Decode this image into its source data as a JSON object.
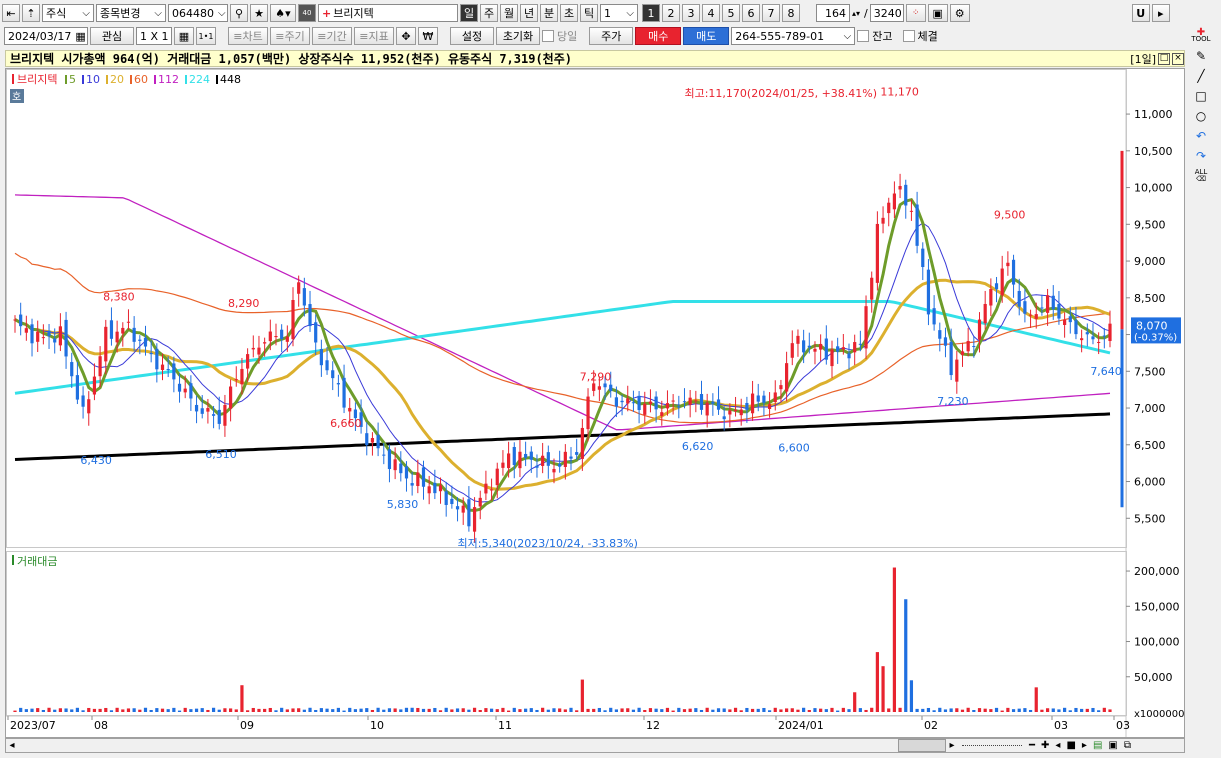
{
  "toolbar": {
    "market": "주식",
    "change_code": "종목변경",
    "code": "064480",
    "stock_name": "브리지텍",
    "periods": [
      "일",
      "주",
      "월",
      "년",
      "분",
      "초",
      "틱"
    ],
    "period_value": "1",
    "pages": [
      "1",
      "2",
      "3",
      "4",
      "5",
      "6",
      "7",
      "8"
    ],
    "count": "164",
    "total": "3240",
    "date": "2024/03/17",
    "watch": "관심",
    "layout": "1 X 1",
    "layout2": "1•1",
    "tabs": [
      "차트",
      "주기",
      "기간",
      "지표"
    ],
    "setting": "설정",
    "reset": "초기화",
    "today": "당일",
    "price_mode": "주가",
    "buy": "매수",
    "sell": "매도",
    "account": "264-555-789-01",
    "balance": "잔고",
    "filled": "체결",
    "u_button": "U",
    "tool_label": "TOOL",
    "all_label": "ALL"
  },
  "info": {
    "text": "브리지텍  시가총액 964(억)  거래대금 1,057(백만)  상장주식수 11,952(천주)  유동주식 7,319(천주)",
    "period_tag": "[1일]"
  },
  "colors": {
    "up": "#e8232f",
    "down": "#1f6fe0",
    "ma5": "#6e9c2a",
    "ma10": "#3a3ad8",
    "ma20": "#dcb02e",
    "ma60": "#e8622a",
    "ma112": "#c020c0",
    "ma224": "#33e0e8",
    "ma448": "#000000"
  },
  "chart_data": {
    "type": "candlestick",
    "title": "브리지텍",
    "legend": [
      "브리지텍",
      "5",
      "10",
      "20",
      "60",
      "112",
      "224",
      "448"
    ],
    "price_axis_ticks": [
      5500,
      6000,
      6500,
      7000,
      7500,
      8000,
      8500,
      9000,
      9500,
      10000,
      10500,
      11000
    ],
    "price_axis_labels": [
      "5,500",
      "6,000",
      "6,500",
      "7,000",
      "7,500",
      "8,000",
      "8,500",
      "9,000",
      "9,500",
      "10,000",
      "10,500",
      "11,000"
    ],
    "ylim": [
      5150,
      11450
    ],
    "current_price": "8,070",
    "current_change": "(-0.37%)",
    "x_labels": [
      "2023/07",
      "08",
      "09",
      "10",
      "11",
      "12",
      "2024/01",
      "02",
      "03",
      "03"
    ],
    "annotations": [
      {
        "text": "8,380",
        "value": 8380,
        "kind": "high"
      },
      {
        "text": "8,290",
        "value": 8290,
        "kind": "high"
      },
      {
        "text": "6,660",
        "value": 6660,
        "kind": "high"
      },
      {
        "text": "7,290",
        "value": 7290,
        "kind": "high"
      },
      {
        "text": "11,170",
        "value": 11170,
        "kind": "high"
      },
      {
        "text": "9,500",
        "value": 9500,
        "kind": "high"
      },
      {
        "text": "6,430",
        "value": 6430,
        "kind": "low"
      },
      {
        "text": "6,510",
        "value": 6510,
        "kind": "low"
      },
      {
        "text": "5,830",
        "value": 5830,
        "kind": "low"
      },
      {
        "text": "6,620",
        "value": 6620,
        "kind": "low"
      },
      {
        "text": "6,600",
        "value": 6600,
        "kind": "low"
      },
      {
        "text": "7,230",
        "value": 7230,
        "kind": "low"
      },
      {
        "text": "7,640",
        "value": 7640,
        "kind": "low"
      }
    ],
    "max_label": "최고:11,170(2024/01/25, +38.41%)",
    "min_label": "최저:5,340(2023/10/24, -33.83%)",
    "volume_title": "거래대금",
    "volume_ticks": [
      "50,000",
      "100,000",
      "150,000",
      "200,000"
    ],
    "volume_unit": "x1000000",
    "volume_ylim": [
      0,
      210000
    ],
    "anchor_closes": [
      [
        0,
        8150
      ],
      [
        4,
        7950
      ],
      [
        8,
        8000
      ],
      [
        12,
        6900
      ],
      [
        16,
        8000
      ],
      [
        20,
        8100
      ],
      [
        24,
        7700
      ],
      [
        28,
        7400
      ],
      [
        32,
        7000
      ],
      [
        36,
        6850
      ],
      [
        40,
        7600
      ],
      [
        44,
        7950
      ],
      [
        48,
        8000
      ],
      [
        50,
        8750
      ],
      [
        53,
        7800
      ],
      [
        57,
        7250
      ],
      [
        61,
        6700
      ],
      [
        65,
        6350
      ],
      [
        69,
        6050
      ],
      [
        73,
        5950
      ],
      [
        77,
        5700
      ],
      [
        80,
        5500
      ],
      [
        83,
        5900
      ],
      [
        87,
        6350
      ],
      [
        91,
        6300
      ],
      [
        95,
        6200
      ],
      [
        99,
        6400
      ],
      [
        102,
        7400
      ],
      [
        106,
        7100
      ],
      [
        110,
        7050
      ],
      [
        114,
        7000
      ],
      [
        118,
        7100
      ],
      [
        122,
        7050
      ],
      [
        126,
        6900
      ],
      [
        130,
        7100
      ],
      [
        134,
        7100
      ],
      [
        137,
        7900
      ],
      [
        141,
        7800
      ],
      [
        145,
        7750
      ],
      [
        149,
        7850
      ],
      [
        152,
        9400
      ],
      [
        155,
        10000
      ],
      [
        158,
        9700
      ],
      [
        161,
        8350
      ],
      [
        165,
        7550
      ],
      [
        169,
        7950
      ],
      [
        172,
        8600
      ],
      [
        175,
        8950
      ],
      [
        178,
        8200
      ],
      [
        182,
        8450
      ],
      [
        186,
        8100
      ],
      [
        190,
        7900
      ],
      [
        193,
        8070
      ]
    ],
    "volume_spikes": [
      [
        40,
        38000
      ],
      [
        70,
        6000
      ],
      [
        100,
        46000
      ],
      [
        148,
        28000
      ],
      [
        152,
        85000
      ],
      [
        153,
        65000
      ],
      [
        155,
        205000
      ],
      [
        157,
        160000
      ],
      [
        158,
        45000
      ],
      [
        180,
        35000
      ]
    ]
  }
}
